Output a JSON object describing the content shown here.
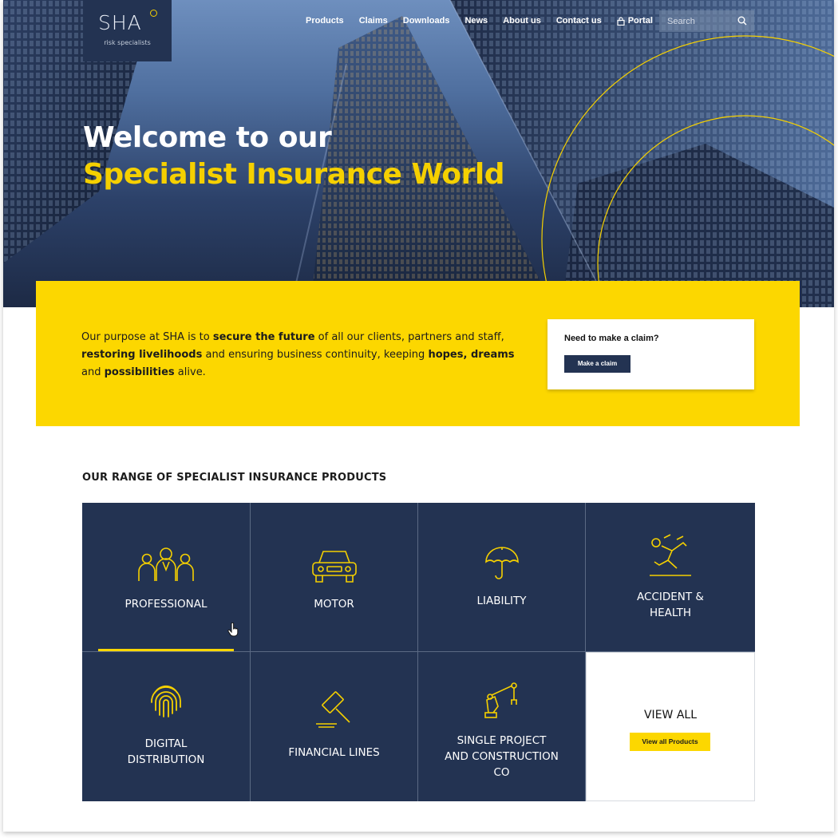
{
  "brand": {
    "logo_text": "SHA",
    "logo_tagline": "risk specialists",
    "accent": "#fcd700",
    "navy": "#233352"
  },
  "nav": {
    "items": [
      "Products",
      "Claims",
      "Downloads",
      "News",
      "About us",
      "Contact us"
    ],
    "portal_label": "Portal",
    "portal_icon": "lock-icon"
  },
  "search": {
    "placeholder": "Search",
    "icon": "search-icon"
  },
  "hero": {
    "title_line1": "Welcome to our",
    "title_line2": "Specialist Insurance World"
  },
  "purpose": {
    "t1": "Our purpose at SHA is to ",
    "b1": "secure the future",
    "t2": " of all our clients, partners and staff,  ",
    "b2": "restoring livelihoods",
    "t3": " and ensuring business continuity, keeping ",
    "b3": "hopes, dreams",
    "t4": " and ",
    "b4": "possibilities",
    "t5": " alive."
  },
  "claim": {
    "title": "Need to make a claim?",
    "button": "Make a claim"
  },
  "products": {
    "section_title": "OUR RANGE OF SPECIALIST INSURANCE PRODUCTS",
    "tiles": [
      {
        "label": "PROFESSIONAL",
        "icon": "people-group-icon"
      },
      {
        "label": "MOTOR",
        "icon": "car-icon"
      },
      {
        "label": "LIABILITY",
        "icon": "umbrella-icon"
      },
      {
        "label": "ACCIDENT &\nHEALTH",
        "icon": "slipping-person-icon"
      },
      {
        "label": "DIGITAL\nDISTRIBUTION",
        "icon": "fingerprint-icon"
      },
      {
        "label": "FINANCIAL LINES",
        "icon": "gavel-icon"
      },
      {
        "label": "SINGLE PROJECT\nAND CONSTRUCTION\nCO",
        "icon": "robot-arm-icon"
      }
    ],
    "view_all_title": "VIEW ALL",
    "view_all_button": "View all Products"
  }
}
